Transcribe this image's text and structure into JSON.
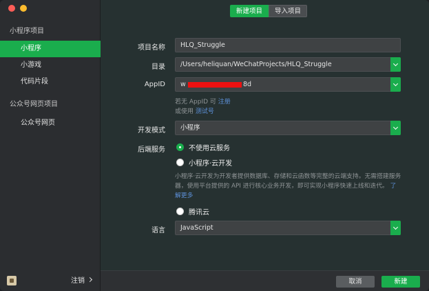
{
  "sidebar": {
    "section_miniprogram": "小程序项目",
    "items": [
      {
        "label": "小程序",
        "active": true
      },
      {
        "label": "小游戏",
        "active": false
      },
      {
        "label": "代码片段",
        "active": false
      }
    ],
    "section_official": "公众号网页项目",
    "official_item": "公众号网页",
    "logout": "注销"
  },
  "tabs": {
    "new_project": "新建项目",
    "import_project": "导入项目"
  },
  "form": {
    "name_label": "项目名称",
    "name_value": "HLQ_Struggle",
    "dir_label": "目录",
    "dir_value": "/Users/heliquan/WeChatProjects/HLQ_Struggle",
    "appid_label": "AppID",
    "appid_prefix": "w",
    "appid_suffix": "8d",
    "appid_hint_prefix": "若无 AppID 可",
    "appid_hint_link": "注册",
    "appid_hint2_prefix": "或使用",
    "appid_hint2_link": "测试号",
    "mode_label": "开发模式",
    "mode_value": "小程序",
    "backend_label": "后端服务",
    "backend_options": {
      "no_cloud": "不使用云服务",
      "cloud_dev": "小程序·云开发",
      "tencent_cloud": "腾讯云"
    },
    "cloud_desc": "小程序·云开发为开发者提供数据库、存储和云函数等完整的云端支持。无需搭建服务器，使用平台提供的 API 进行核心业务开发，即可实现小程序快速上线和迭代。",
    "cloud_desc_link": "了解更多",
    "lang_label": "语言",
    "lang_value": "JavaScript"
  },
  "footer": {
    "cancel": "取消",
    "create": "新建"
  },
  "colors": {
    "accent": "#1aad4d",
    "link": "#5c8fd6",
    "redaction": "#ee1111"
  }
}
